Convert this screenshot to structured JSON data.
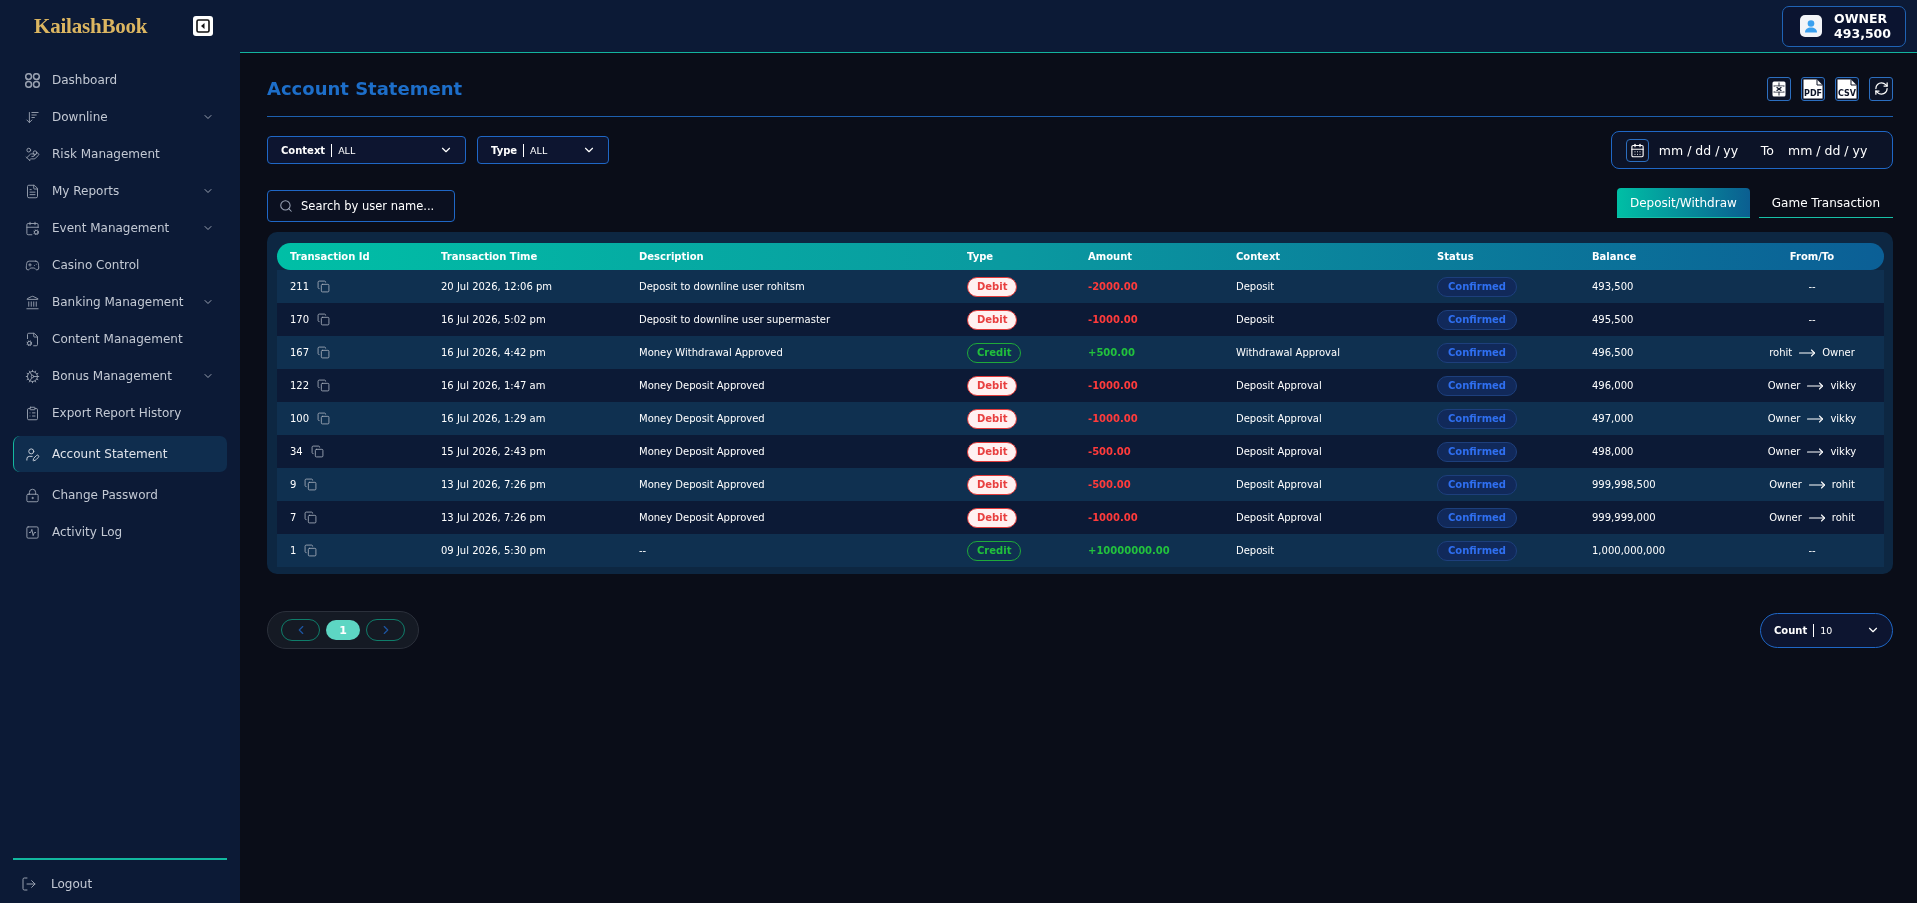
{
  "sidebar": {
    "logo": "KailashBook",
    "items": [
      {
        "label": "Dashboard",
        "has_submenu": false,
        "selected": false
      },
      {
        "label": "Downline",
        "has_submenu": true,
        "selected": false
      },
      {
        "label": "Risk Management",
        "has_submenu": false,
        "selected": false
      },
      {
        "label": "My Reports",
        "has_submenu": true,
        "selected": false
      },
      {
        "label": "Event Management",
        "has_submenu": true,
        "selected": false
      },
      {
        "label": "Casino Control",
        "has_submenu": false,
        "selected": false
      },
      {
        "label": "Banking Management",
        "has_submenu": true,
        "selected": false
      },
      {
        "label": "Content Management",
        "has_submenu": false,
        "selected": false
      },
      {
        "label": "Bonus Management",
        "has_submenu": true,
        "selected": false
      },
      {
        "label": "Export Report History",
        "has_submenu": false,
        "selected": false
      },
      {
        "label": "Account Statement",
        "has_submenu": false,
        "selected": true
      },
      {
        "label": "Change Password",
        "has_submenu": false,
        "selected": false
      },
      {
        "label": "Activity Log",
        "has_submenu": false,
        "selected": false
      }
    ],
    "logout": "Logout"
  },
  "header": {
    "user": {
      "role": "OWNER",
      "balance": "493,500"
    }
  },
  "page": {
    "title": "Account Statement",
    "export_buttons": [
      {
        "kind": "excel"
      },
      {
        "kind": "pdf",
        "label": "PDF"
      },
      {
        "kind": "csv",
        "label": "CSV"
      },
      {
        "kind": "refresh"
      }
    ]
  },
  "filters": [
    {
      "label": "Context",
      "value": "ALL"
    },
    {
      "label": "Type",
      "value": "ALL"
    }
  ],
  "date_range": {
    "from_placeholder": "mm / dd / yy",
    "separator": "To",
    "to_placeholder": "mm / dd / yy"
  },
  "search": {
    "placeholder": "Search by user name..."
  },
  "tabs": [
    {
      "label": "Deposit/Withdraw",
      "selected": true
    },
    {
      "label": "Game Transaction",
      "selected": false
    }
  ],
  "table": {
    "columns": [
      "Transaction Id",
      "Transaction Time",
      "Description",
      "Type",
      "Amount",
      "Context",
      "Status",
      "Balance",
      "From/To"
    ],
    "rows": [
      {
        "id": "211",
        "time": "20 Jul 2026, 12:06 pm",
        "description": "Deposit to downline user rohitsm",
        "type": {
          "kind": "debit",
          "label": "Debit"
        },
        "amount": "-2000.00",
        "context": "Deposit",
        "status": "Confirmed",
        "balance": "493,500",
        "from_to": {
          "kind": "none",
          "text": "--"
        }
      },
      {
        "id": "170",
        "time": "16 Jul 2026, 5:02 pm",
        "description": "Deposit to downline user supermaster",
        "type": {
          "kind": "debit",
          "label": "Debit"
        },
        "amount": "-1000.00",
        "context": "Deposit",
        "status": "Confirmed",
        "balance": "495,500",
        "from_to": {
          "kind": "none",
          "text": "--"
        }
      },
      {
        "id": "167",
        "time": "16 Jul 2026, 4:42 pm",
        "description": "Money Withdrawal Approved",
        "type": {
          "kind": "credit",
          "label": "Credit"
        },
        "amount": "+500.00",
        "context": "Withdrawal Approval",
        "status": "Confirmed",
        "balance": "496,500",
        "from_to": {
          "kind": "transfer",
          "from": "rohit",
          "to": "Owner"
        }
      },
      {
        "id": "122",
        "time": "16 Jul 2026, 1:47 am",
        "description": "Money Deposit Approved",
        "type": {
          "kind": "debit",
          "label": "Debit"
        },
        "amount": "-1000.00",
        "context": "Deposit Approval",
        "status": "Confirmed",
        "balance": "496,000",
        "from_to": {
          "kind": "transfer",
          "from": "Owner",
          "to": "vikky"
        }
      },
      {
        "id": "100",
        "time": "16 Jul 2026, 1:29 am",
        "description": "Money Deposit Approved",
        "type": {
          "kind": "debit",
          "label": "Debit"
        },
        "amount": "-1000.00",
        "context": "Deposit Approval",
        "status": "Confirmed",
        "balance": "497,000",
        "from_to": {
          "kind": "transfer",
          "from": "Owner",
          "to": "vikky"
        }
      },
      {
        "id": "34",
        "time": "15 Jul 2026, 2:43 pm",
        "description": "Money Deposit Approved",
        "type": {
          "kind": "debit",
          "label": "Debit"
        },
        "amount": "-500.00",
        "context": "Deposit Approval",
        "status": "Confirmed",
        "balance": "498,000",
        "from_to": {
          "kind": "transfer",
          "from": "Owner",
          "to": "vikky"
        }
      },
      {
        "id": "9",
        "time": "13 Jul 2026, 7:26 pm",
        "description": "Money Deposit Approved",
        "type": {
          "kind": "debit",
          "label": "Debit"
        },
        "amount": "-500.00",
        "context": "Deposit Approval",
        "status": "Confirmed",
        "balance": "999,998,500",
        "from_to": {
          "kind": "transfer",
          "from": "Owner",
          "to": "rohit"
        }
      },
      {
        "id": "7",
        "time": "13 Jul 2026, 7:26 pm",
        "description": "Money Deposit Approved",
        "type": {
          "kind": "debit",
          "label": "Debit"
        },
        "amount": "-1000.00",
        "context": "Deposit Approval",
        "status": "Confirmed",
        "balance": "999,999,000",
        "from_to": {
          "kind": "transfer",
          "from": "Owner",
          "to": "rohit"
        }
      },
      {
        "id": "1",
        "time": "09 Jul 2026, 5:30 pm",
        "description": "--",
        "type": {
          "kind": "credit",
          "label": "Credit"
        },
        "amount": "+10000000.00",
        "context": "Deposit",
        "status": "Confirmed",
        "balance": "1,000,000,000",
        "from_to": {
          "kind": "none",
          "text": "--"
        }
      }
    ]
  },
  "pagination": {
    "pages": [
      {
        "label": "1",
        "selected": true
      }
    ]
  },
  "count": {
    "label": "Count",
    "value": "10"
  }
}
